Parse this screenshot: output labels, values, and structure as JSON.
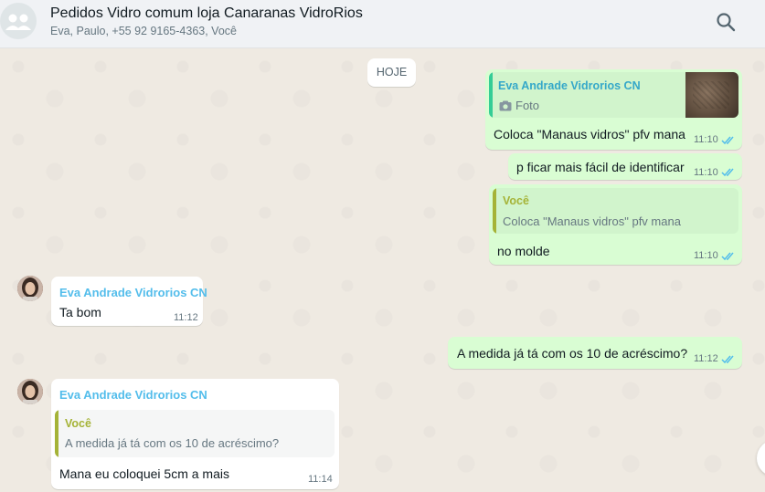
{
  "header": {
    "title": "Pedidos Vidro comum loja Canaranas VidroRios",
    "subtitle": "Eva, Paulo, +55 92 9165-4363, Você",
    "search_icon": "search-icon",
    "avatar_icon": "group-avatar-icon"
  },
  "chat": {
    "day_label": "HOJE",
    "messages": [
      {
        "direction": "out",
        "quote_author": "Eva Andrade Vidrorios CN",
        "quote_media_icon": "camera-icon",
        "quote_media_label": "Foto",
        "text": "Coloca \"Manaus vidros\" pfv mana",
        "time": "11:10",
        "status": "read"
      },
      {
        "direction": "out",
        "text": "p ficar mais fácil de identificar",
        "time": "11:10",
        "status": "read"
      },
      {
        "direction": "out",
        "quote_author": "Você",
        "quote_text": "Coloca \"Manaus vidros\" pfv mana",
        "text": "no molde",
        "time": "11:10",
        "status": "read"
      },
      {
        "direction": "in",
        "sender": "Eva Andrade Vidrorios CN",
        "text": "Ta bom",
        "time": "11:12"
      },
      {
        "direction": "out",
        "text": "A medida já tá com os 10 de acréscimo?",
        "time": "11:12",
        "status": "read"
      },
      {
        "direction": "in",
        "sender": "Eva Andrade Vidrorios CN",
        "quote_author": "Você",
        "quote_text": "A medida já tá com os 10 de acréscimo?",
        "text": "Mana eu coloquei 5cm a mais",
        "time": "11:14"
      }
    ]
  },
  "colors": {
    "outgoing_bubble": "#d9fdd3",
    "incoming_bubble": "#ffffff",
    "read_ticks": "#53bdeb",
    "quote_bar_self": "#a5b337"
  }
}
